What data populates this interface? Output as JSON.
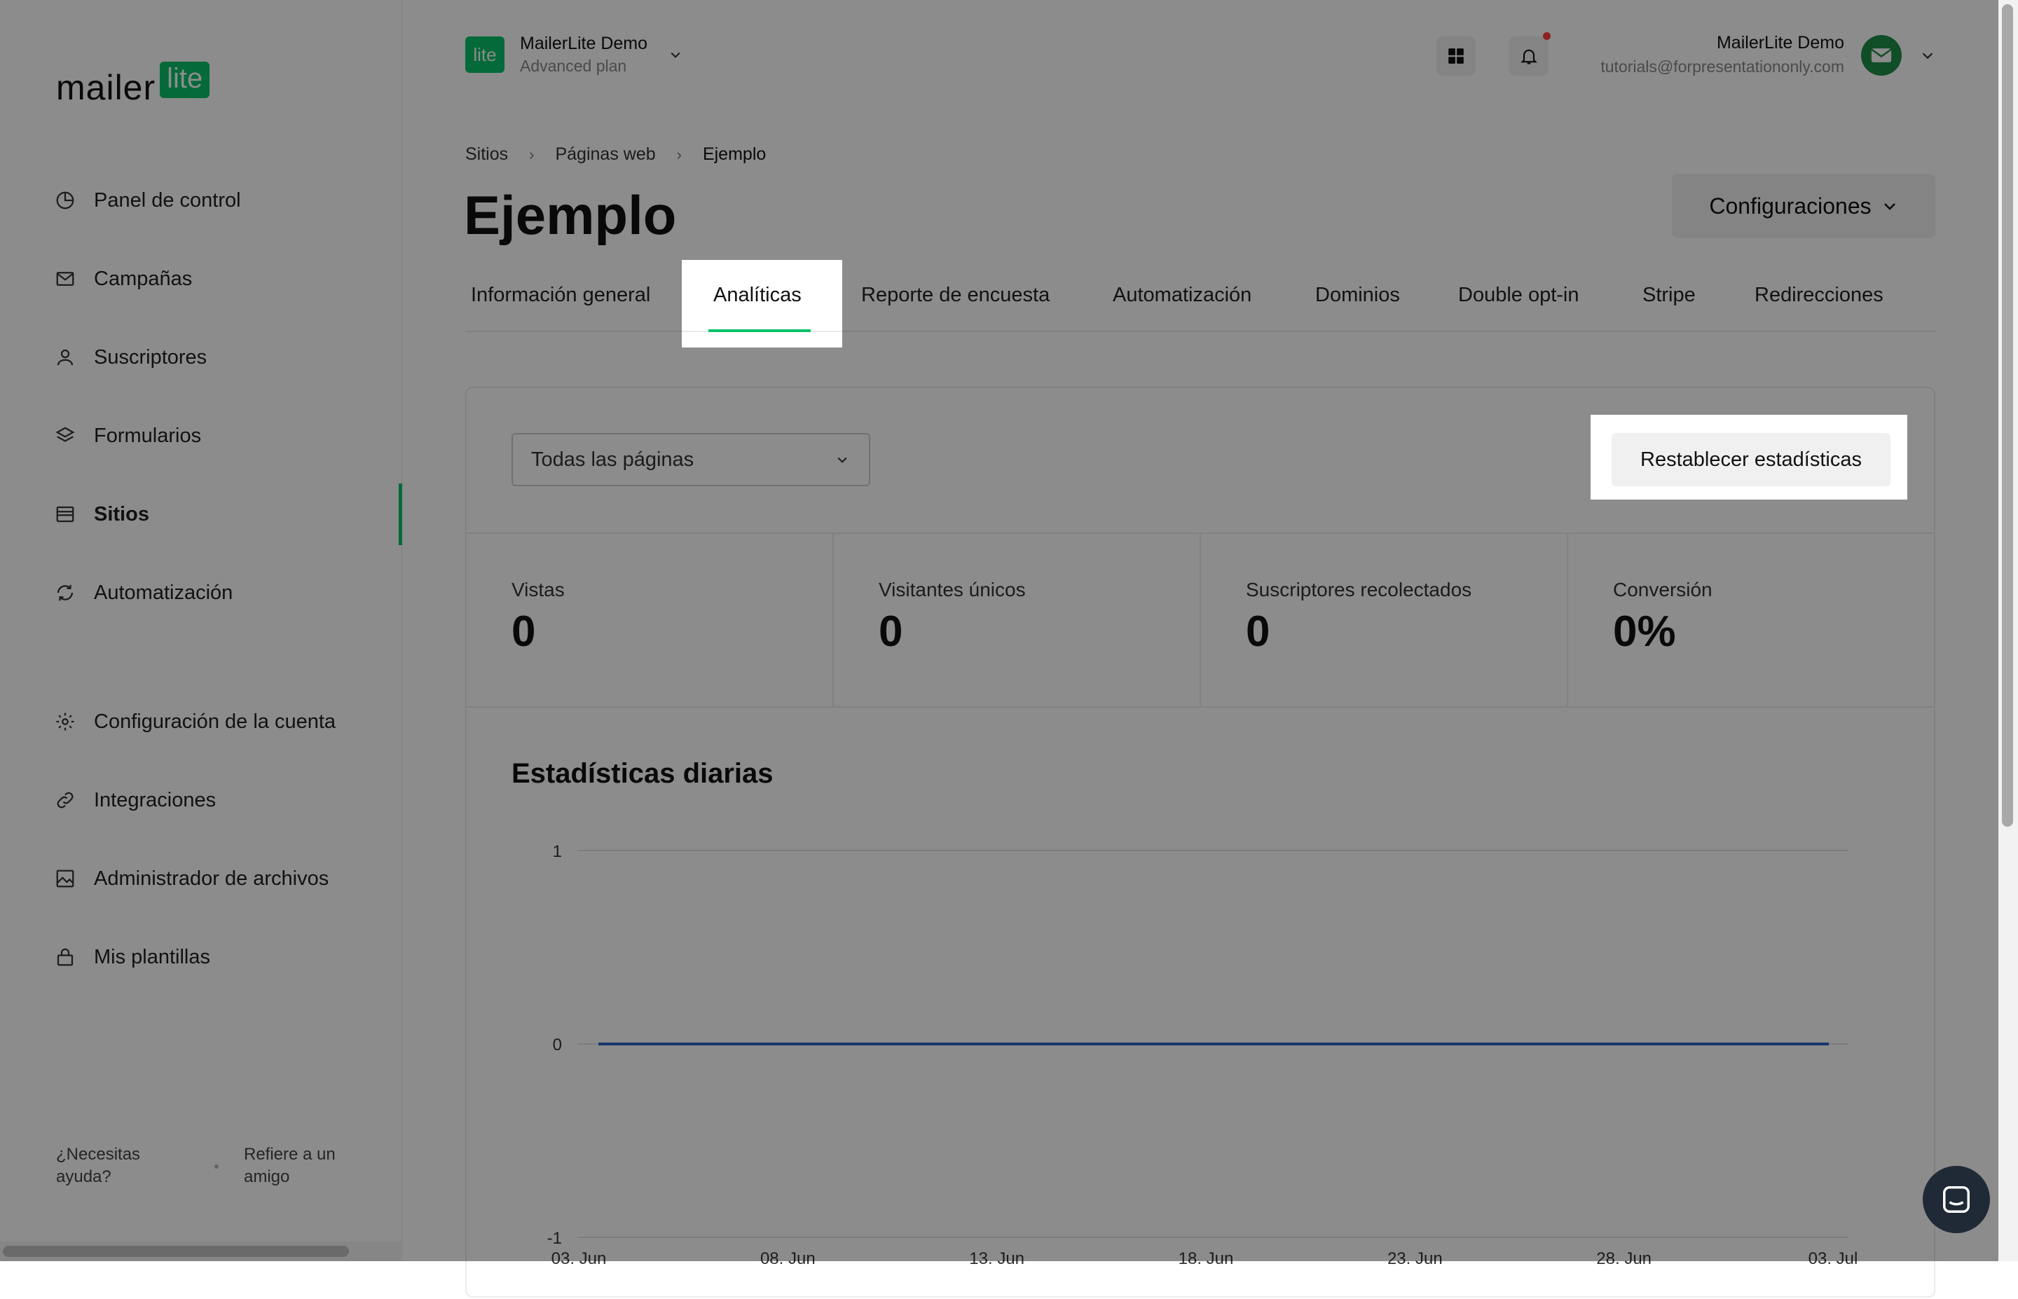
{
  "brand": {
    "logo_word": "mailer",
    "logo_badge": "lite"
  },
  "sidebar": {
    "items": [
      {
        "label": "Panel de control",
        "icon": "chart-pie-icon"
      },
      {
        "label": "Campañas",
        "icon": "mail-icon"
      },
      {
        "label": "Suscriptores",
        "icon": "user-icon"
      },
      {
        "label": "Formularios",
        "icon": "layers-icon"
      },
      {
        "label": "Sitios",
        "icon": "browser-icon",
        "active": true
      },
      {
        "label": "Automatización",
        "icon": "refresh-icon"
      },
      {
        "label": "Configuración de la cuenta",
        "icon": "gear-icon"
      },
      {
        "label": "Integraciones",
        "icon": "link-icon"
      },
      {
        "label": "Administrador de archivos",
        "icon": "image-icon"
      },
      {
        "label": "Mis plantillas",
        "icon": "lock-icon"
      }
    ],
    "help_label": "¿Necesitas ayuda?",
    "refer_label": "Refiere a un amigo"
  },
  "account": {
    "logo_text": "lite",
    "name": "MailerLite Demo",
    "plan": "Advanced plan"
  },
  "user": {
    "name": "MailerLite Demo",
    "email": "tutorials@forpresentationonly.com"
  },
  "breadcrumb": [
    "Sitios",
    "Páginas web",
    "Ejemplo"
  ],
  "page": {
    "title": "Ejemplo",
    "config_label": "Configuraciones"
  },
  "tabs": [
    {
      "label": "Información general"
    },
    {
      "label": "Analíticas",
      "active": true
    },
    {
      "label": "Reporte de encuesta"
    },
    {
      "label": "Automatización"
    },
    {
      "label": "Dominios"
    },
    {
      "label": "Double opt-in"
    },
    {
      "label": "Stripe"
    },
    {
      "label": "Redirecciones"
    }
  ],
  "filter": {
    "selected": "Todas las páginas"
  },
  "reset_label": "Restablecer estadísticas",
  "stats": [
    {
      "label": "Vistas",
      "value": "0"
    },
    {
      "label": "Visitantes únicos",
      "value": "0"
    },
    {
      "label": "Suscriptores recolectados",
      "value": "0"
    },
    {
      "label": "Conversión",
      "value": "0%"
    }
  ],
  "daily_title": "Estadísticas diarias",
  "colors": {
    "accent": "#09c269",
    "line": "#2f62c8",
    "overlay": "rgba(0,0,0,0.45)"
  },
  "chart_data": {
    "type": "line",
    "title": "Estadísticas diarias",
    "ylim": [
      -1,
      1
    ],
    "yticks": [
      "1",
      "0",
      "-1"
    ],
    "xticks": [
      "03. Jun",
      "08. Jun",
      "13. Jun",
      "18. Jun",
      "23. Jun",
      "28. Jun",
      "03. Jul"
    ],
    "series": [
      {
        "values": [
          0,
          0,
          0,
          0,
          0,
          0,
          0
        ]
      }
    ],
    "grid": true
  }
}
